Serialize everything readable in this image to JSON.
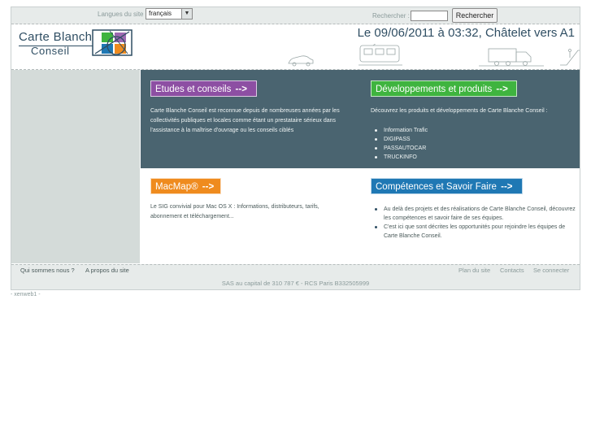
{
  "topbar": {
    "lang_label": "Langues du site",
    "lang_value": "français",
    "search_label": "Rechercher",
    "search_value": "",
    "search_button": "Rechercher"
  },
  "header": {
    "logo_top": "Carte Blanche",
    "logo_bottom": "Conseil",
    "date_line": "Le 09/06/2011 à 03:32, Châtelet vers A1"
  },
  "sections": {
    "etudes": {
      "title": "Etudes et conseils",
      "arrow": "-->",
      "color": "#8d4fa3",
      "text": "Carte Blanche Conseil est reconnue depuis de nombreuses années par les collectivités publiques et locales comme étant un prestataire sérieux dans l'assistance à la maîtrise d'ouvrage ou les conseils ciblés"
    },
    "developpements": {
      "title": "Développements et produits",
      "arrow": "-->",
      "color": "#3fb43f",
      "text": "Découvrez les produits et développements de Carte Blanche Conseil :",
      "items": [
        "Information Trafic",
        "DIGIPASS",
        "PASSAUTOCAR",
        "TRUCKINFO"
      ]
    },
    "macmap": {
      "title": "MacMap®",
      "arrow": "-->",
      "color": "#ef8b1e",
      "text": "Le SIG convivial pour Mac OS X : Informations, distributeurs, tarifs, abonnement et téléchargement..."
    },
    "competences": {
      "title": "Compétences et Savoir Faire",
      "arrow": "-->",
      "color": "#1f78b4",
      "items": [
        "Au delà des projets et des réalisations de Carte Blanche Conseil, découvrez les compétences et savoir faire de ses équipes.",
        "C'est ici que sont décrites les opportunités pour rejoindre les équipes de Carte Blanche Conseil."
      ]
    }
  },
  "footer": {
    "left_links": [
      "Qui sommes nous ?",
      "A propos du site"
    ],
    "right_links": [
      "Plan du site",
      "Contacts",
      "Se connecter"
    ],
    "legal": "SAS au capital de 310 787 € - RCS Paris B332505999",
    "server": "- xenweb1 -"
  },
  "colors": {
    "dark_band": "#4a6470",
    "left_column": "#d4dbd9",
    "brand_text": "#2f4e63"
  },
  "icons": [
    "language-select-arrow-icon",
    "car-icon",
    "tram-icon",
    "truck-icon",
    "escalator-icon",
    "logo-mark-icon"
  ]
}
